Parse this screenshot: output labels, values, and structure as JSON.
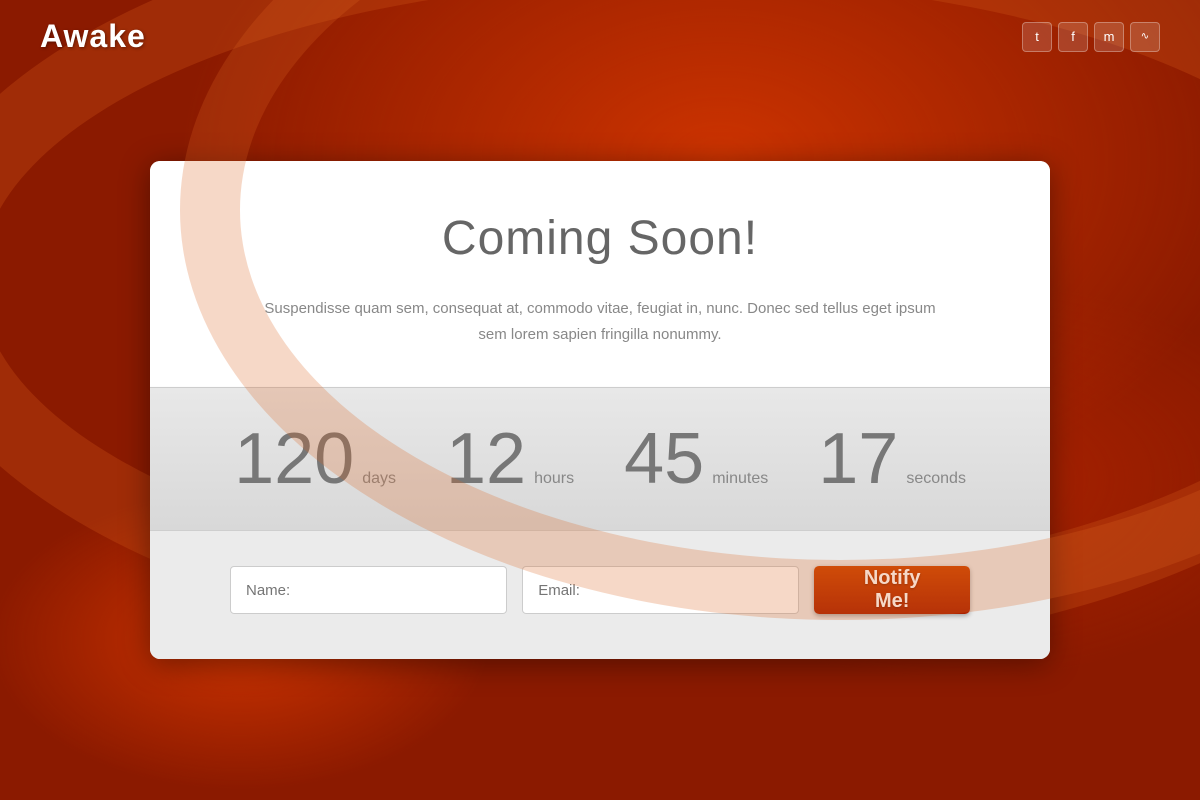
{
  "header": {
    "logo": "Awake",
    "social": {
      "twitter_label": "t",
      "facebook_label": "f",
      "myspace_label": "m",
      "rss_label": "rss"
    }
  },
  "main": {
    "title": "Coming Soon!",
    "description": "Suspendisse quam sem, consequat at, commodo vitae, feugiat in, nunc. Donec sed tellus eget ipsum sem lorem sapien fringilla nonummy.",
    "countdown": {
      "days_value": "120",
      "days_label": "days",
      "hours_value": "12",
      "hours_label": "hours",
      "minutes_value": "45",
      "minutes_label": "minutes",
      "seconds_value": "17",
      "seconds_label": "seconds"
    },
    "form": {
      "name_placeholder": "Name:",
      "email_placeholder": "Email:",
      "notify_button": "Notify Me!"
    }
  }
}
